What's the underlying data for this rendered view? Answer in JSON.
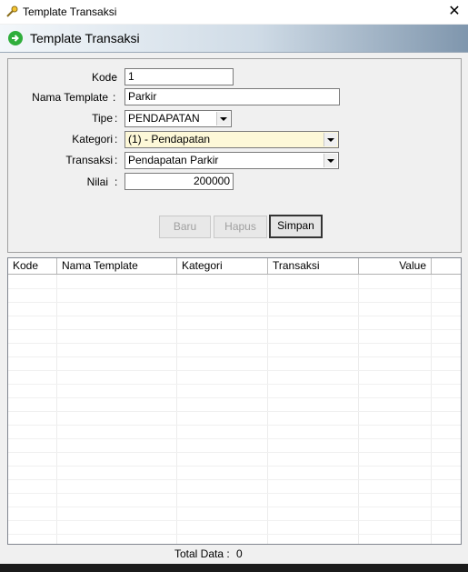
{
  "window": {
    "title": "Template Transaksi",
    "close_glyph": "✕"
  },
  "header": {
    "title": "Template Transaksi",
    "icon": "green-arrow-go-icon"
  },
  "form": {
    "kode": {
      "label": "Kode",
      "value": "1"
    },
    "nama_template": {
      "label": "Nama Template",
      "value": "Parkir"
    },
    "tipe": {
      "label": "Tipe",
      "value": "PENDAPATAN"
    },
    "kategori": {
      "label": "Kategori",
      "value": "(1) - Pendapatan",
      "highlight": "#fdf8d8"
    },
    "transaksi": {
      "label": "Transaksi",
      "value": "Pendapatan Parkir"
    },
    "nilai": {
      "label": "Nilai",
      "value": "200000"
    },
    "colon": ":"
  },
  "buttons": {
    "baru": "Baru",
    "hapus": "Hapus",
    "simpan": "Simpan"
  },
  "table": {
    "columns": [
      "Kode",
      "Nama Template",
      "Kategori",
      "Transaksi",
      "Value"
    ],
    "rows": []
  },
  "footer": {
    "total_label": "Total Data :",
    "total_value": "0"
  }
}
